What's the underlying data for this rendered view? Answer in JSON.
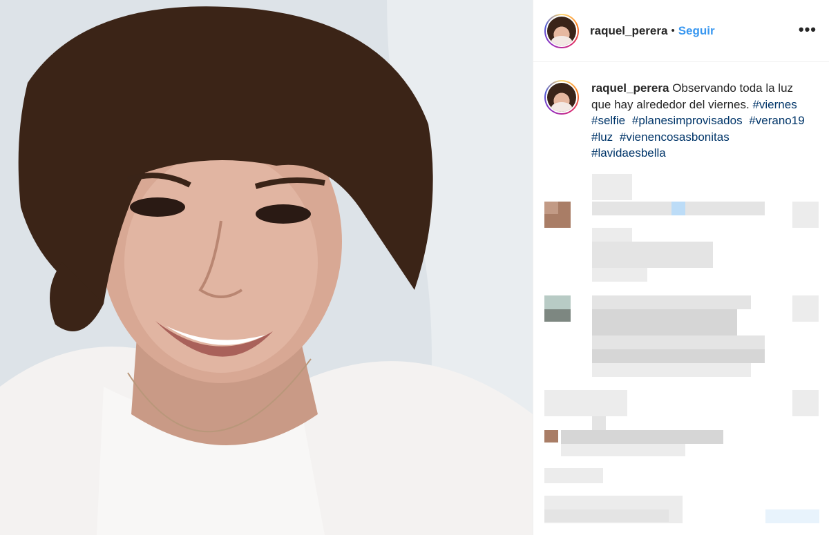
{
  "post": {
    "username": "raquel_perera",
    "separator": "•",
    "follow_label": "Seguir",
    "more_icon": "more-options-icon",
    "caption": {
      "username": "raquel_perera",
      "text": "Observando toda la luz que hay alrededor del viernes.",
      "hashtags": [
        "#viernes",
        "#selfie",
        "#planesimprovisados",
        "#verano19",
        "#luz",
        "#vienencosasbonitas",
        "#lavidaesbella"
      ]
    }
  },
  "colors": {
    "follow": "#3897f0",
    "hashtag": "#003569",
    "text": "#262626",
    "border": "#efefef"
  }
}
